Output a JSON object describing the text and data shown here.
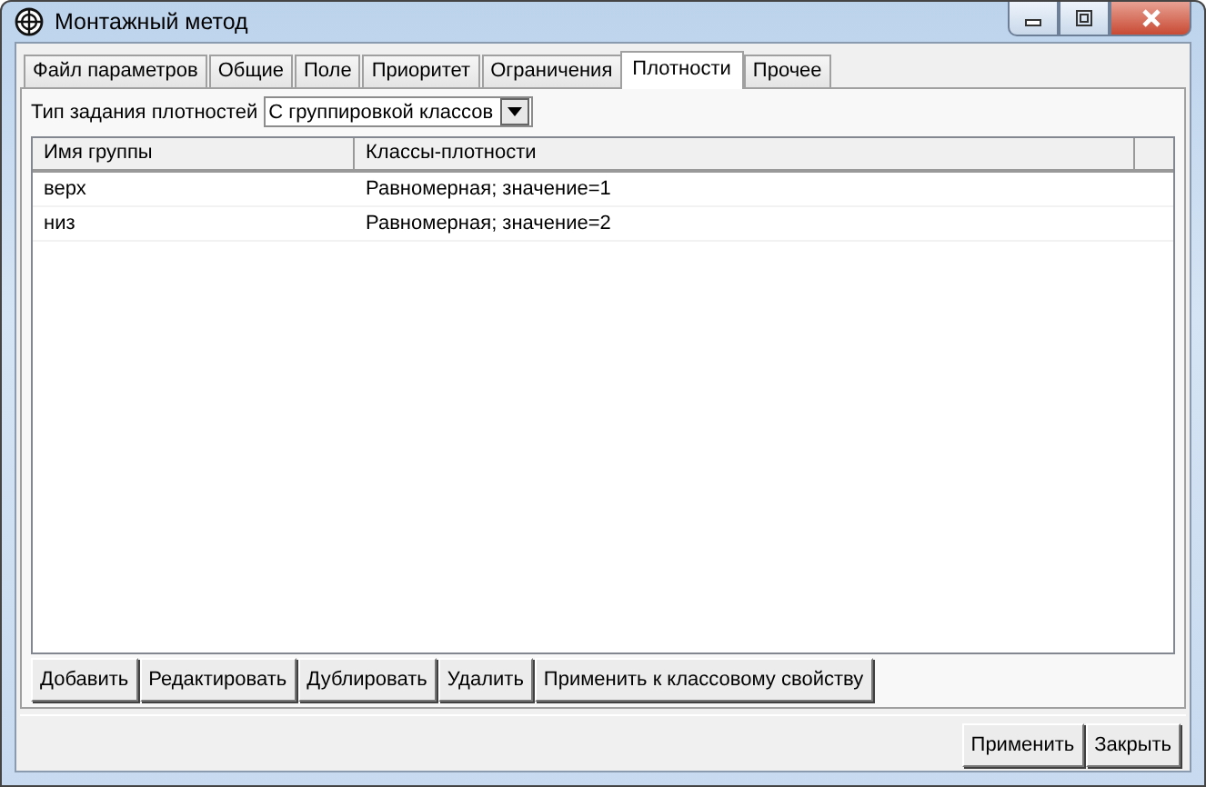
{
  "window": {
    "title": "Монтажный метод"
  },
  "tabs": [
    {
      "label": "Файл параметров",
      "selected": false
    },
    {
      "label": "Общие",
      "selected": false
    },
    {
      "label": "Поле",
      "selected": false
    },
    {
      "label": "Приоритет",
      "selected": false
    },
    {
      "label": "Ограничения",
      "selected": false
    },
    {
      "label": "Плотности",
      "selected": true
    },
    {
      "label": "Прочее",
      "selected": false
    }
  ],
  "density_type": {
    "label": "Тип задания плотностей",
    "value": "С группировкой классов"
  },
  "table": {
    "columns": [
      "Имя группы",
      "Классы-плотности"
    ],
    "rows": [
      [
        "верх",
        "Равномерная; значение=1"
      ],
      [
        "низ",
        "Равномерная; значение=2"
      ]
    ]
  },
  "actions": [
    "Добавить",
    "Редактировать",
    "Дублировать",
    "Удалить",
    "Применить к классовому свойству"
  ],
  "buttons": [
    "Применить",
    "Закрыть"
  ]
}
